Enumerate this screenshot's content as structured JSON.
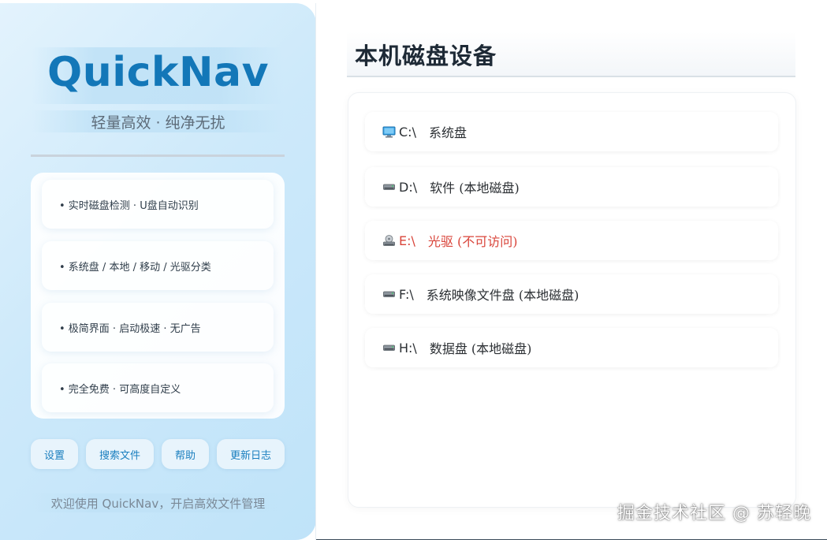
{
  "sidebar": {
    "brand": "QuickNav",
    "tagline": "轻量高效 · 纯净无扰",
    "features": [
      "• 实时磁盘检测 · U盘自动识别",
      "• 系统盘 / 本地 / 移动 / 光驱分类",
      "• 极简界面 · 启动极速 · 无广告",
      "• 完全免费 · 可高度自定义"
    ],
    "buttons": {
      "settings": "设置",
      "search": "搜索文件",
      "help": "帮助",
      "changelog": "更新日志"
    },
    "welcome": "欢迎使用 QuickNav，开启高效文件管理"
  },
  "main": {
    "title": "本机磁盘设备",
    "disks": [
      {
        "letter": "C:\\",
        "label": "系统盘",
        "icon": "monitor-icon",
        "status": "ok"
      },
      {
        "letter": "D:\\",
        "label": "软件 (本地磁盘)",
        "icon": "drive-icon",
        "status": "ok"
      },
      {
        "letter": "E:\\",
        "label": "光驱 (不可访问)",
        "icon": "optical-drive-icon",
        "status": "error"
      },
      {
        "letter": "F:\\",
        "label": "系统映像文件盘 (本地磁盘)",
        "icon": "drive-icon",
        "status": "ok"
      },
      {
        "letter": "H:\\",
        "label": "数据盘 (本地磁盘)",
        "icon": "drive-icon",
        "status": "ok"
      }
    ]
  },
  "watermark": "掘金技术社区 @ 苏轻晚",
  "colors": {
    "brand": "#1377b8",
    "button_text": "#1b7fbf",
    "error": "#d9443a"
  }
}
